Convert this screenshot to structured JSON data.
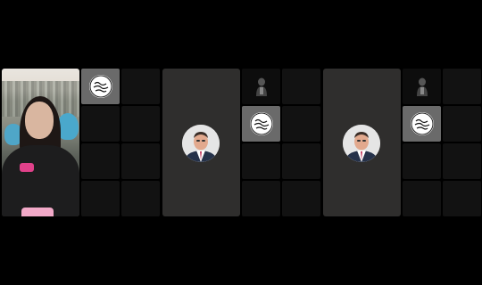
{
  "call": {
    "panels": [
      {
        "main_tile": {
          "type": "camera",
          "participant": "selfie-video"
        },
        "grid": [
          "logo-badge",
          "empty",
          "empty",
          "empty",
          "empty",
          "empty",
          "empty",
          "empty"
        ]
      },
      {
        "main_tile": {
          "type": "avatar",
          "participant": "profile-photo"
        },
        "grid": [
          "person-thumb",
          "empty",
          "logo-badge",
          "empty",
          "empty",
          "empty",
          "empty",
          "empty"
        ]
      },
      {
        "main_tile": {
          "type": "avatar",
          "participant": "profile-photo"
        },
        "grid": [
          "person-thumb",
          "empty",
          "logo-badge",
          "empty",
          "empty",
          "empty",
          "empty",
          "empty"
        ]
      }
    ]
  },
  "colors": {
    "background": "#000000",
    "tile": "#2f2e2d",
    "empty_cell": "#121212",
    "highlight_cell": "#6a6a6a"
  },
  "icons": [
    "avatar-icon",
    "logo-badge-icon",
    "person-thumbnail-icon"
  ]
}
